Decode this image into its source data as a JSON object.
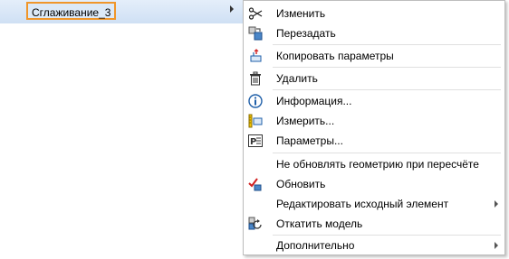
{
  "tree": {
    "selected_label": "Сглаживание_3"
  },
  "menu": {
    "items": [
      {
        "label": "Изменить",
        "icon": "edit-scissors-icon"
      },
      {
        "label": "Перезадать",
        "icon": "redefine-icon"
      },
      {
        "label": "Копировать параметры",
        "icon": "copy-params-icon"
      },
      {
        "label": "Удалить",
        "icon": "trash-icon"
      },
      {
        "label": "Информация...",
        "icon": "info-icon"
      },
      {
        "label": "Измерить...",
        "icon": "measure-icon"
      },
      {
        "label": "Параметры...",
        "icon": "params-icon"
      },
      {
        "label": "Не обновлять геометрию при пересчёте",
        "icon": ""
      },
      {
        "label": "Обновить",
        "icon": "update-check-icon"
      },
      {
        "label": "Редактировать исходный элемент",
        "icon": ""
      },
      {
        "label": "Откатить модель",
        "icon": "rollback-icon"
      },
      {
        "label": "Дополнительно",
        "icon": ""
      }
    ]
  },
  "colors": {
    "selection_border": "#f0962a",
    "tree_background": "#dce9f7",
    "icon_blue": "#1f5fa8",
    "icon_red": "#d11f1f"
  }
}
